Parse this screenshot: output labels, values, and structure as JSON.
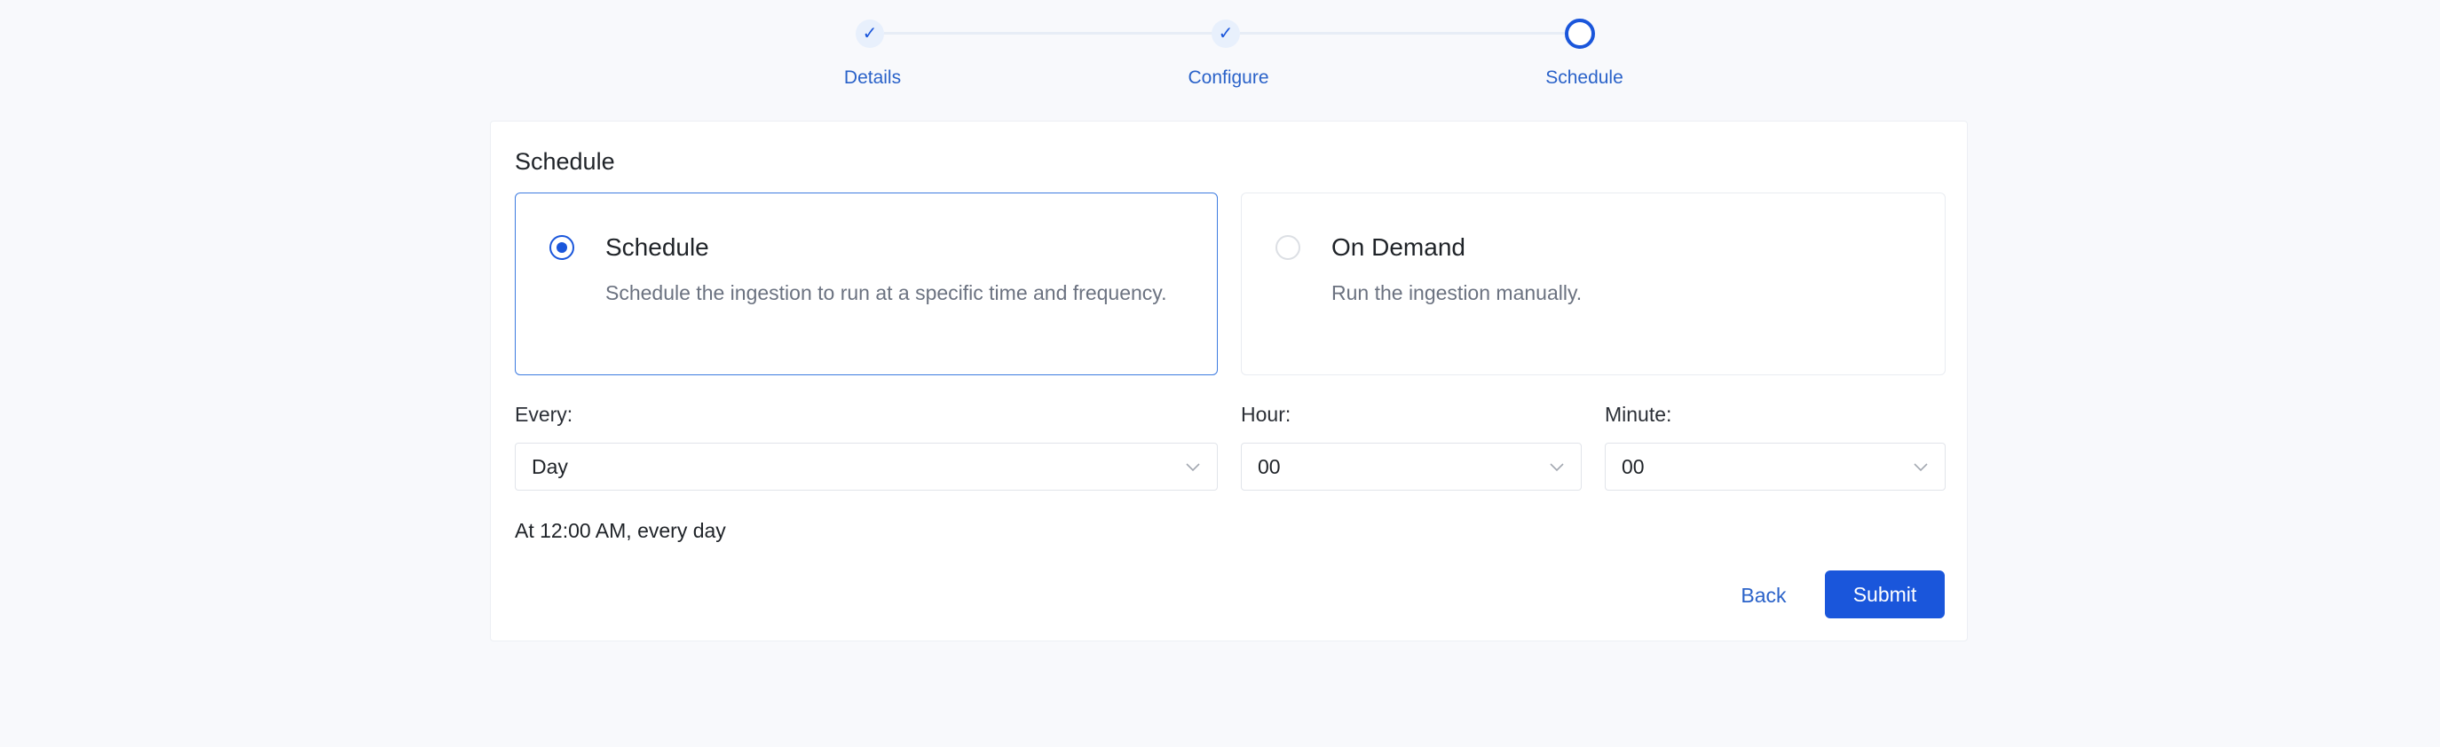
{
  "stepper": {
    "steps": [
      {
        "label": "Details",
        "state": "done"
      },
      {
        "label": "Configure",
        "state": "done"
      },
      {
        "label": "Schedule",
        "state": "current"
      }
    ],
    "done_icon": "check-icon"
  },
  "form": {
    "title": "Schedule",
    "options": [
      {
        "title": "Schedule",
        "description": "Schedule the ingestion to run at a specific time and frequency.",
        "selected": true
      },
      {
        "title": "On Demand",
        "description": "Run the ingestion manually.",
        "selected": false
      }
    ],
    "every": {
      "label": "Every:",
      "value": "Day"
    },
    "hour": {
      "label": "Hour:",
      "value": "00"
    },
    "minute": {
      "label": "Minute:",
      "value": "00"
    },
    "summary": "At 12:00 AM, every day",
    "back_label": "Back",
    "submit_label": "Submit"
  },
  "colors": {
    "accent": "#1a56db",
    "link": "#2a62c9",
    "background": "#f8f9fc"
  }
}
